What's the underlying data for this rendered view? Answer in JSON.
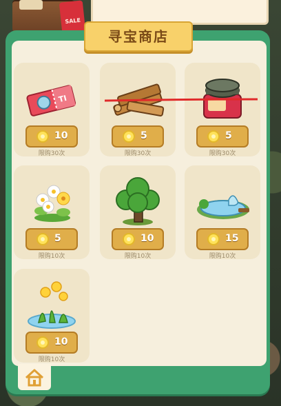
{
  "header": {
    "sale_tag_text": "SALE"
  },
  "shop": {
    "title": "寻宝商店",
    "items": [
      {
        "name": "ticket",
        "price": "10",
        "limit": "限购30次",
        "icon": "ticket-icon"
      },
      {
        "name": "wood",
        "price": "5",
        "limit": "限购30次",
        "icon": "wood-logs-icon"
      },
      {
        "name": "jar",
        "price": "5",
        "limit": "限购30次",
        "icon": "jar-icon"
      },
      {
        "name": "flowers",
        "price": "5",
        "limit": "限购10次",
        "icon": "flowers-icon"
      },
      {
        "name": "tree",
        "price": "10",
        "limit": "限购10次",
        "icon": "tree-icon"
      },
      {
        "name": "pond",
        "price": "15",
        "limit": "限购10次",
        "icon": "pond-icon"
      },
      {
        "name": "daffodils",
        "price": "10",
        "limit": "限购10次",
        "icon": "daffodils-icon"
      }
    ]
  },
  "colors": {
    "frame_green": "#3ea270",
    "panel_cream": "#f6efdd",
    "card_bg": "#f0e5c9",
    "button_gold": "#e0ae4a",
    "strike_red": "#e02a2a"
  },
  "nav": {
    "home_icon": "house-icon"
  }
}
